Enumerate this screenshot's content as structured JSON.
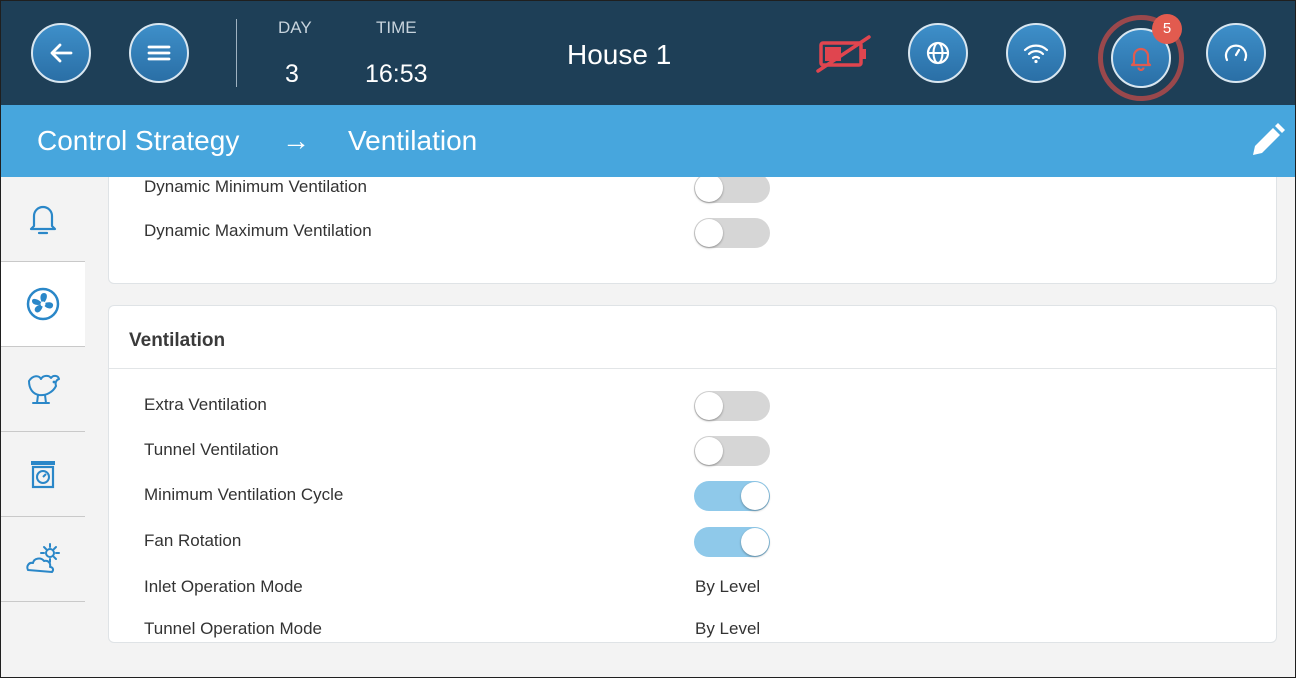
{
  "header": {
    "day_label": "DAY",
    "day_value": "3",
    "time_label": "TIME",
    "time_value": "16:53",
    "house": "House 1",
    "alarm_count": "5",
    "icons": [
      "back-arrow-icon",
      "menu-icon",
      "battery-off-icon",
      "globe-icon",
      "wifi-icon",
      "bell-icon",
      "gauge-icon"
    ]
  },
  "titlebar": {
    "crumb_1": "Control Strategy",
    "arrow": "→",
    "crumb_2": "Ventilation",
    "edit_icon": "pencil-icon"
  },
  "sidebar": {
    "items": [
      "bell-icon",
      "fan-icon",
      "bird-icon",
      "scale-icon",
      "weather-icon"
    ]
  },
  "dynamic_card": {
    "rows": [
      {
        "label": "Dynamic Minimum Ventilation",
        "state": "off"
      },
      {
        "label": "Dynamic Maximum Ventilation",
        "state": "off"
      }
    ]
  },
  "ventilation_card": {
    "title": "Ventilation",
    "rows": [
      {
        "label": "Extra Ventilation",
        "state": "off"
      },
      {
        "label": "Tunnel Ventilation",
        "state": "off"
      },
      {
        "label": "Minimum Ventilation Cycle",
        "state": "on"
      },
      {
        "label": "Fan Rotation",
        "state": "on"
      },
      {
        "label": "Inlet Operation Mode",
        "value": "By Level"
      },
      {
        "label": "Tunnel Operation Mode",
        "value": "By Level"
      }
    ]
  },
  "colors": {
    "topbar": "#1e3f57",
    "titlebar": "#47a6dd",
    "button": "#3585bf",
    "toggle_on": "#8fc9ea",
    "toggle_off": "#d6d6d6",
    "badge": "#e25b4f",
    "battery_alert": "#e0454f"
  }
}
